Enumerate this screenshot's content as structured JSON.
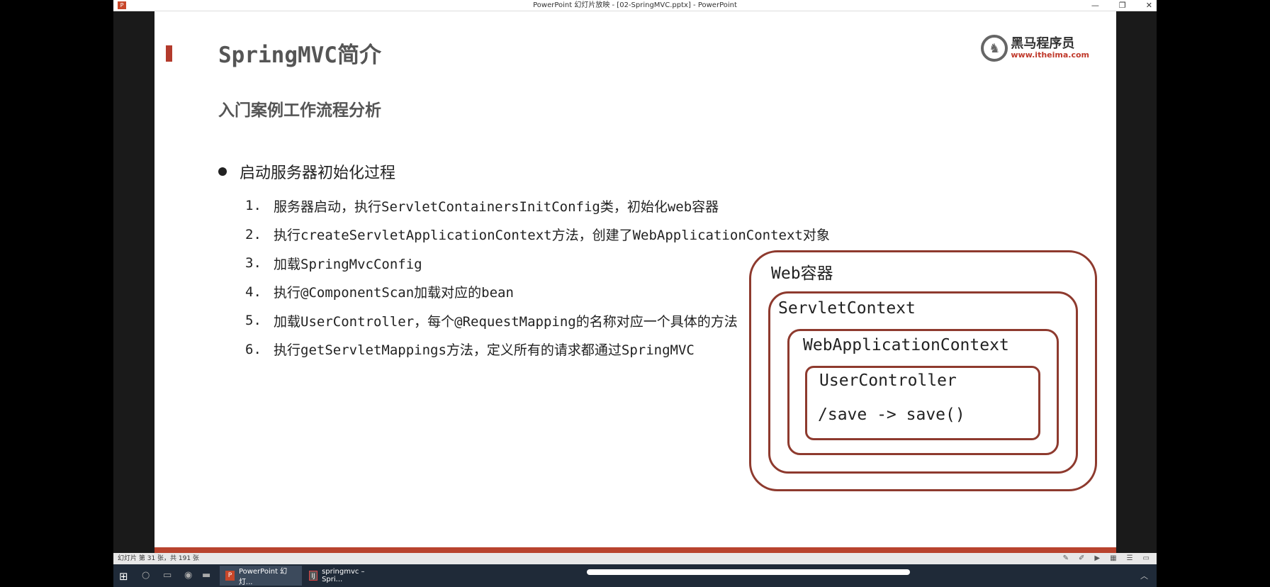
{
  "window": {
    "title": "PowerPoint 幻灯片放映 - [02-SpringMVC.pptx] - PowerPoint",
    "app_icon": "P",
    "controls": [
      "—",
      "❐",
      "✕"
    ]
  },
  "slide": {
    "title": "SpringMVC简介",
    "logo": {
      "name": "黑马程序员",
      "url": "www.itheima.com",
      "glyph": "♞"
    },
    "subtitle": "入门案例工作流程分析",
    "bullet": "启动服务器初始化过程",
    "steps": [
      {
        "num": "1.",
        "text": "服务器启动，执行ServletContainersInitConfig类，初始化web容器"
      },
      {
        "num": "2.",
        "text": "执行createServletApplicationContext方法，创建了WebApplicationContext对象"
      },
      {
        "num": "3.",
        "text": "加载SpringMvcConfig"
      },
      {
        "num": "4.",
        "text": "执行@ComponentScan加载对应的bean"
      },
      {
        "num": "5.",
        "text": "加载UserController，每个@RequestMapping的名称对应一个具体的方法"
      },
      {
        "num": "6.",
        "text": "执行getServletMappings方法，定义所有的请求都通过SpringMVC"
      }
    ],
    "diagram": {
      "web_container": "Web容器",
      "servlet_context": "ServletContext",
      "web_app_context": "WebApplicationContext",
      "user_controller": "UserController",
      "mapping": "/save -> save()"
    }
  },
  "statusbar": {
    "text": "幻灯片 第 31 张，共 191 张"
  },
  "taskbar": {
    "ppt_label": "PowerPoint 幻灯...",
    "idea_label": "springmvc – Spri..."
  },
  "colors": {
    "accent": "#b33a2c",
    "box_border": "#8e3a2e",
    "logo_url": "#c0392b"
  }
}
